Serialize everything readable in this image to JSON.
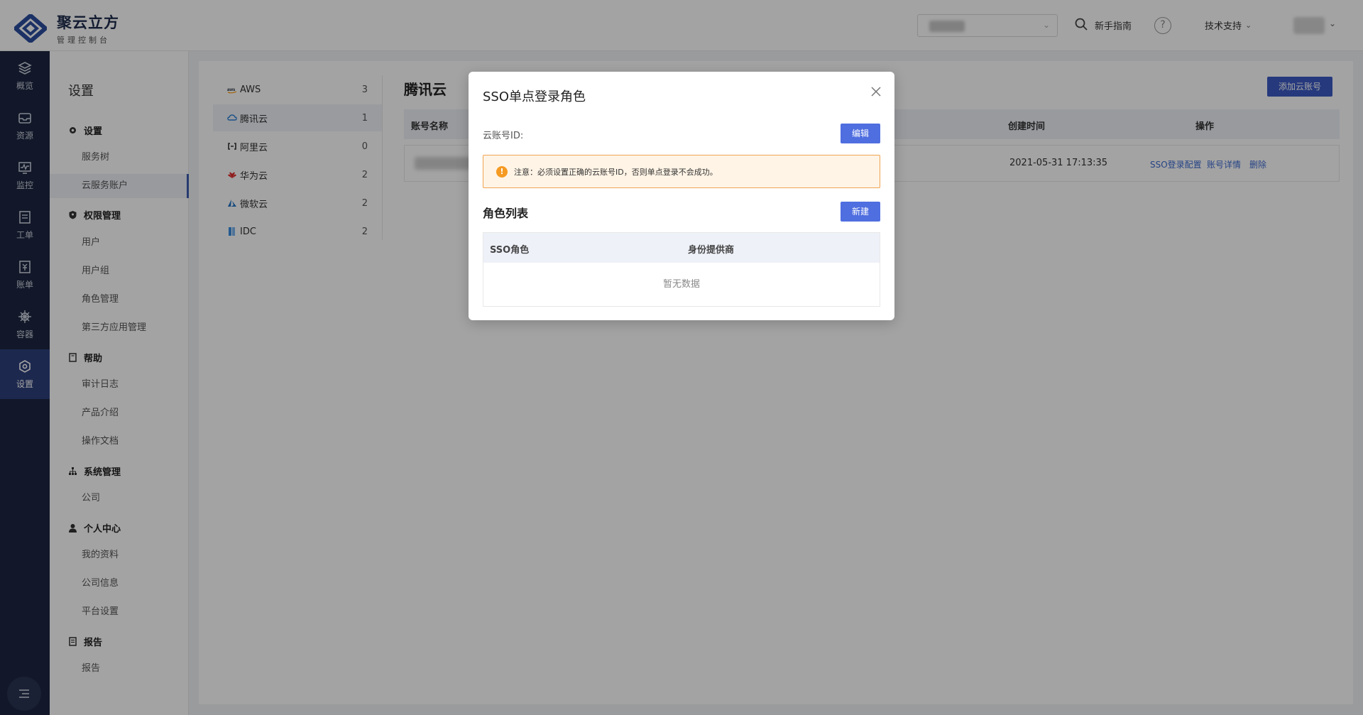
{
  "brand": {
    "title": "聚云立方",
    "subtitle": "管理控制台"
  },
  "header": {
    "guide_label": "新手指南",
    "help_icon": "?",
    "support_label": "技术支持"
  },
  "iconbar": {
    "items": [
      {
        "label": "概览",
        "icon": "layers-icon"
      },
      {
        "label": "资源",
        "icon": "inbox-icon"
      },
      {
        "label": "监控",
        "icon": "monitor-chart-icon"
      },
      {
        "label": "工单",
        "icon": "ticket-icon"
      },
      {
        "label": "账单",
        "icon": "bill-icon"
      },
      {
        "label": "容器",
        "icon": "helm-icon"
      },
      {
        "label": "设置",
        "icon": "settings-icon"
      }
    ],
    "active": "设置"
  },
  "subnav": {
    "title": "设置",
    "groups": [
      {
        "label": "设置",
        "items": [
          "服务树",
          "云服务账户"
        ]
      },
      {
        "label": "权限管理",
        "items": [
          "用户",
          "用户组",
          "角色管理",
          "第三方应用管理"
        ]
      },
      {
        "label": "帮助",
        "items": [
          "审计日志",
          "产品介绍",
          "操作文档"
        ]
      },
      {
        "label": "系统管理",
        "items": [
          "公司"
        ]
      },
      {
        "label": "个人中心",
        "items": [
          "我的资料",
          "公司信息",
          "平台设置"
        ]
      },
      {
        "label": "报告",
        "items": [
          "报告"
        ]
      }
    ],
    "active_item": "云服务账户"
  },
  "providers": [
    {
      "name": "AWS",
      "count": "3"
    },
    {
      "name": "腾讯云",
      "count": "1"
    },
    {
      "name": "阿里云",
      "count": "0"
    },
    {
      "name": "华为云",
      "count": "2"
    },
    {
      "name": "微软云",
      "count": "2"
    },
    {
      "name": "IDC",
      "count": "2"
    }
  ],
  "main": {
    "title": "腾讯云",
    "add_button": "添加云账号",
    "columns": {
      "name": "账号名称",
      "created": "创建时间",
      "actions": "操作"
    },
    "row": {
      "created": "2021-05-31 17:13:35",
      "actions": [
        "SSO登录配置",
        "账号详情",
        "删除"
      ]
    }
  },
  "modal": {
    "title": "SSO单点登录角色",
    "account_id_label": "云账号ID:",
    "edit_button": "编辑",
    "warning": "注意：必须设置正确的云账号ID，否则单点登录不会成功。",
    "warning_icon": "!",
    "section_title": "角色列表",
    "new_button": "新建",
    "table": {
      "columns": [
        "SSO角色",
        "身份提供商"
      ],
      "empty_text": "暂无数据"
    }
  },
  "colors": {
    "primary": "#4f6ee0",
    "sidebar_bg": "#1d2640",
    "warning_border": "#f1a352",
    "warning_bg": "#fff4e6"
  }
}
